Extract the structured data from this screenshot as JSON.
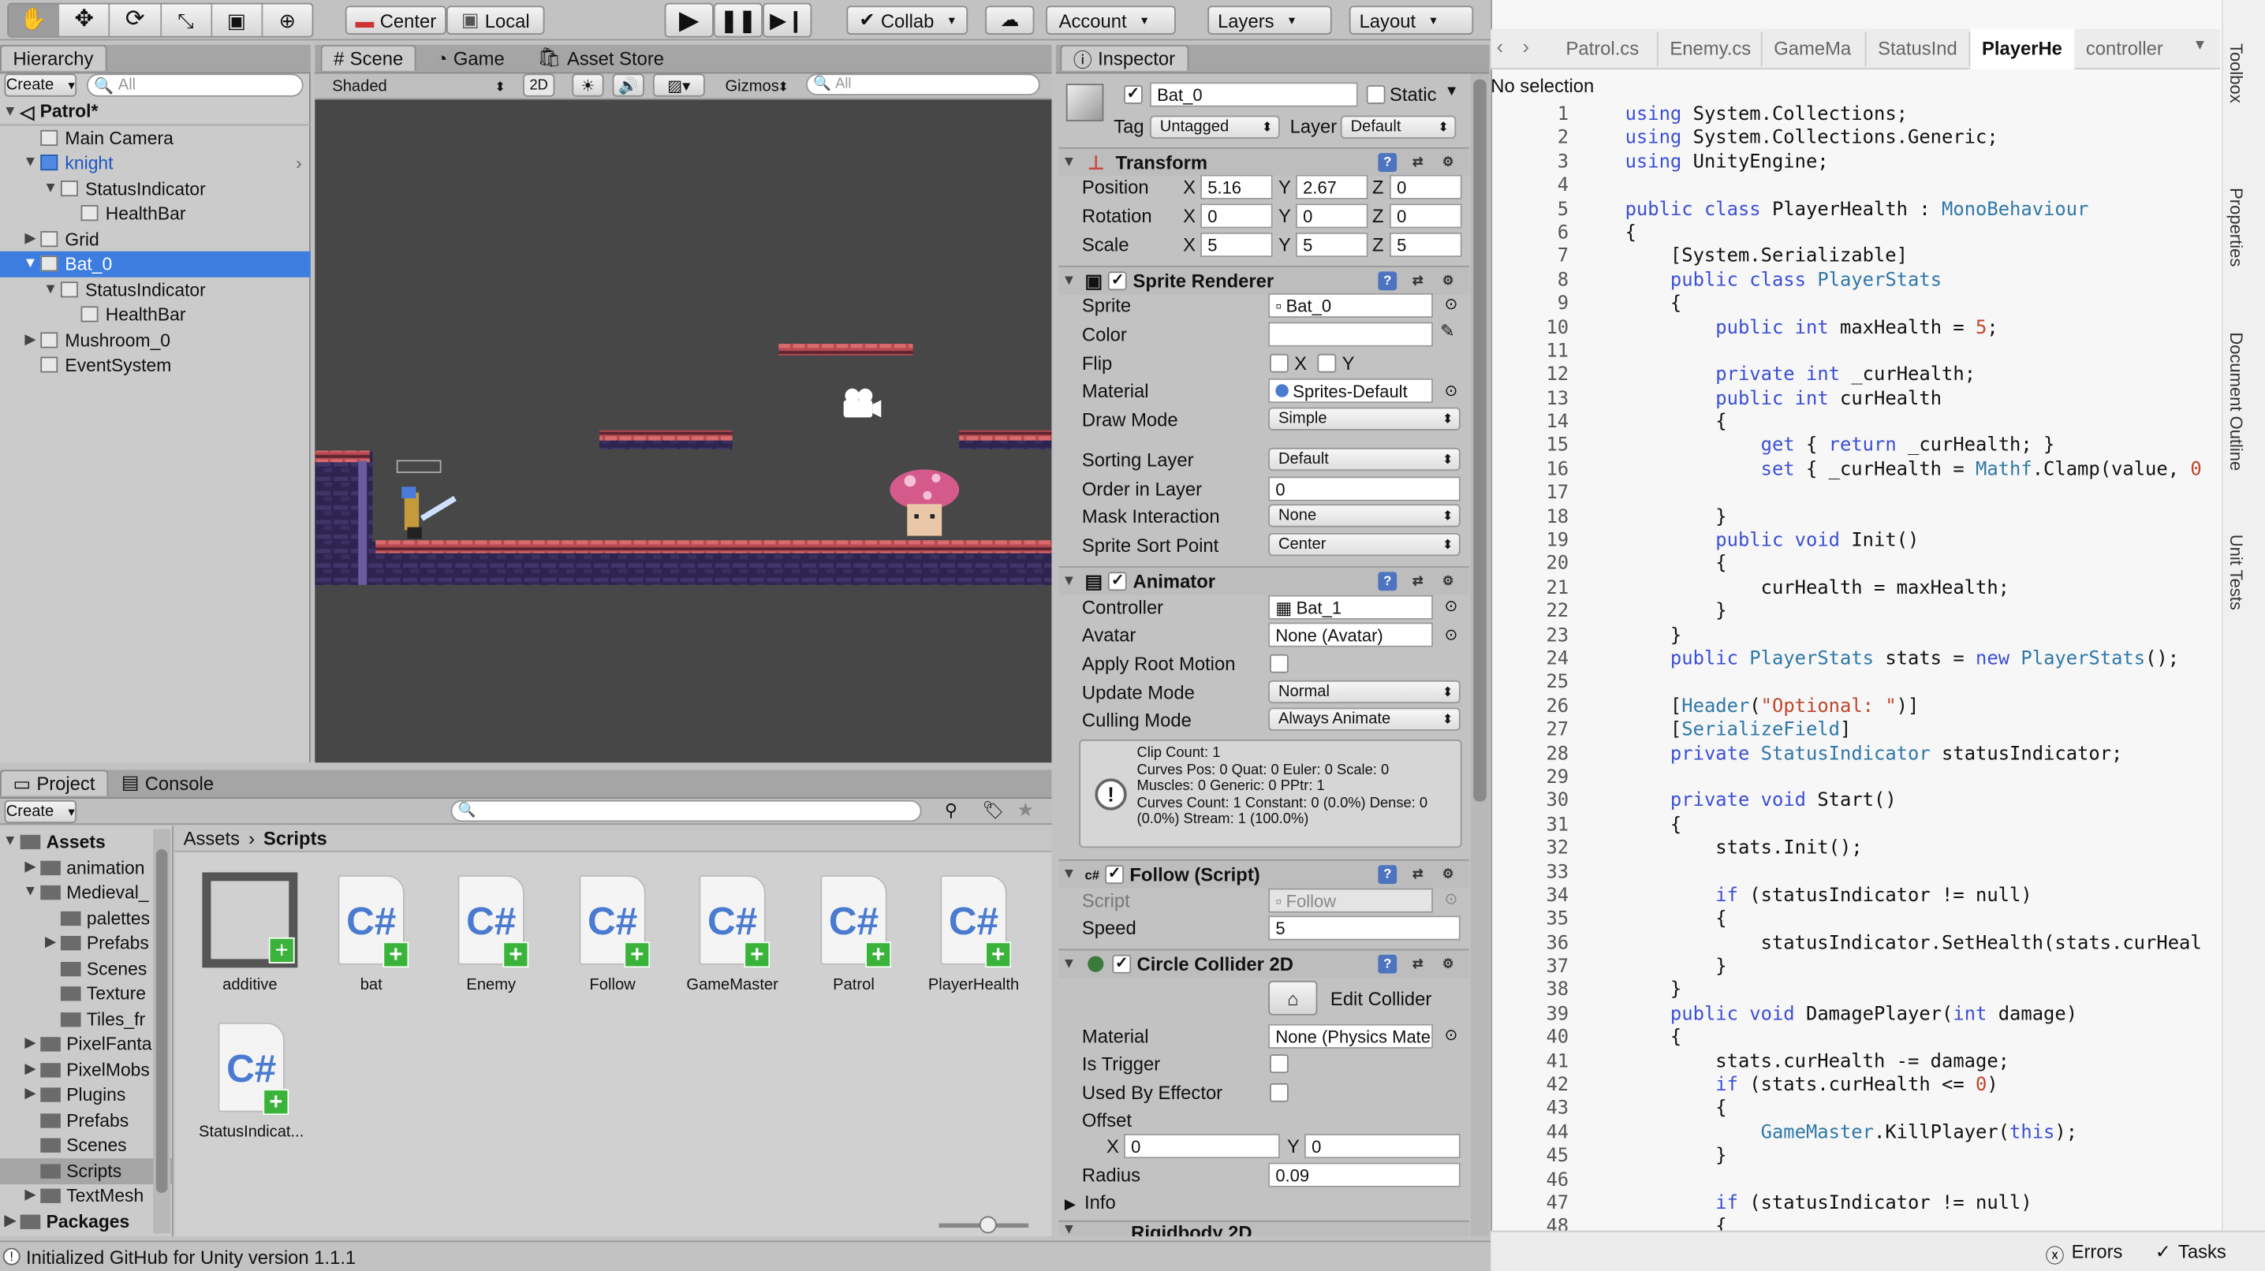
{
  "toolbar": {
    "center_label": "Center",
    "local_label": "Local",
    "collab_label": "Collab",
    "account_label": "Account",
    "layers_label": "Layers",
    "layout_label": "Layout"
  },
  "hierarchy": {
    "tab": "Hierarchy",
    "create": "Create",
    "search_placeholder": "All",
    "scene_name": "Patrol*",
    "items": [
      "Main Camera",
      "knight",
      "StatusIndicator",
      "HealthBar",
      "Grid",
      "Bat_0",
      "StatusIndicator",
      "HealthBar",
      "Mushroom_0",
      "EventSystem"
    ]
  },
  "scene": {
    "tabs": [
      "Scene",
      "Game",
      "Asset Store"
    ],
    "shading": "Shaded",
    "mode2d": "2D",
    "gizmos": "Gizmos",
    "search_placeholder": "All"
  },
  "inspector": {
    "tab": "Inspector",
    "object_name": "Bat_0",
    "static_label": "Static",
    "tag_label": "Tag",
    "tag_value": "Untagged",
    "layer_label": "Layer",
    "layer_value": "Default",
    "transform": {
      "title": "Transform",
      "position_label": "Position",
      "rotation_label": "Rotation",
      "scale_label": "Scale",
      "pos": [
        "5.16",
        "2.67",
        "0"
      ],
      "rot": [
        "0",
        "0",
        "0"
      ],
      "scale": [
        "5",
        "5",
        "5"
      ],
      "x": "X",
      "y": "Y",
      "z": "Z"
    },
    "sprite_renderer": {
      "title": "Sprite Renderer",
      "sprite_label": "Sprite",
      "sprite_value": "Bat_0",
      "color_label": "Color",
      "flip_label": "Flip",
      "flip_x": "X",
      "flip_y": "Y",
      "material_label": "Material",
      "material_value": "Sprites-Default",
      "draw_mode_label": "Draw Mode",
      "draw_mode_value": "Simple",
      "sorting_layer_label": "Sorting Layer",
      "sorting_layer_value": "Default",
      "order_label": "Order in Layer",
      "order_value": "0",
      "mask_label": "Mask Interaction",
      "mask_value": "None",
      "sort_point_label": "Sprite Sort Point",
      "sort_point_value": "Center"
    },
    "animator": {
      "title": "Animator",
      "controller_label": "Controller",
      "controller_value": "Bat_1",
      "avatar_label": "Avatar",
      "avatar_value": "None (Avatar)",
      "root_motion_label": "Apply Root Motion",
      "update_label": "Update Mode",
      "update_value": "Normal",
      "culling_label": "Culling Mode",
      "culling_value": "Always Animate",
      "info": [
        "Clip Count: 1",
        "Curves Pos: 0 Quat: 0 Euler: 0 Scale: 0",
        "Muscles: 0 Generic: 0 PPtr: 1",
        "Curves Count: 1 Constant: 0 (0.0%) Dense: 0",
        "(0.0%) Stream: 1 (100.0%)"
      ]
    },
    "follow": {
      "title": "Follow (Script)",
      "script_label": "Script",
      "script_value": "Follow",
      "speed_label": "Speed",
      "speed_value": "5"
    },
    "collider": {
      "title": "Circle Collider 2D",
      "edit_label": "Edit Collider",
      "material_label": "Material",
      "material_value": "None (Physics Mate",
      "trigger_label": "Is Trigger",
      "effector_label": "Used By Effector",
      "offset_label": "Offset",
      "offset_x": "0",
      "offset_y": "0",
      "radius_label": "Radius",
      "radius_value": "0.09",
      "info_label": "Info"
    },
    "rigidbody_title": "Rigidbody 2D"
  },
  "project": {
    "tabs": [
      "Project",
      "Console"
    ],
    "create": "Create",
    "breadcrumb": [
      "Assets",
      "Scripts"
    ],
    "tree": [
      "Assets",
      "animation",
      "Medieval_",
      "palettes",
      "Prefabs",
      "Scenes",
      "Texture",
      "Tiles_fr",
      "PixelFanta",
      "PixelMobs",
      "Plugins",
      "Prefabs",
      "Scenes",
      "Scripts",
      "TextMesh",
      "Packages"
    ],
    "assets": [
      "additive",
      "bat",
      "Enemy",
      "Follow",
      "GameMaster",
      "Patrol",
      "PlayerHealth",
      "StatusIndicat..."
    ],
    "cs": "C#"
  },
  "status_text": "Initialized GitHub for Unity version 1.1.1",
  "editor": {
    "tabs": [
      "Patrol.cs",
      "Enemy.cs",
      "GameMa",
      "StatusInd",
      "PlayerHe",
      "controller"
    ],
    "no_selection": "No selection",
    "bottom": [
      "Errors",
      "Tasks"
    ],
    "side": [
      "Toolbox",
      "Properties",
      "Document Outline",
      "Unit Tests"
    ],
    "lines": [
      "using System.Collections;",
      "using System.Collections.Generic;",
      "using UnityEngine;",
      "",
      "public class PlayerHealth : MonoBehaviour",
      "{",
      "    [System.Serializable]",
      "    public class PlayerStats",
      "    {",
      "        public int maxHealth = 5;",
      "",
      "        private int _curHealth;",
      "        public int curHealth",
      "        {",
      "            get { return _curHealth; }",
      "            set { _curHealth = Mathf.Clamp(value, 0",
      "",
      "        }",
      "        public void Init()",
      "        {",
      "            curHealth = maxHealth;",
      "        }",
      "    }",
      "    public PlayerStats stats = new PlayerStats();",
      "",
      "    [Header(\"Optional: \")]",
      "    [SerializeField]",
      "    private StatusIndicator statusIndicator;",
      "",
      "    private void Start()",
      "    {",
      "        stats.Init();",
      "",
      "        if (statusIndicator != null)",
      "        {",
      "            statusIndicator.SetHealth(stats.curHeal",
      "        }",
      "    }",
      "    public void DamagePlayer(int damage)",
      "    {",
      "        stats.curHealth -= damage;",
      "        if (stats.curHealth <= 0)",
      "        {",
      "            GameMaster.KillPlayer(this);",
      "        }",
      "",
      "        if (statusIndicator != null)",
      "        {"
    ]
  }
}
